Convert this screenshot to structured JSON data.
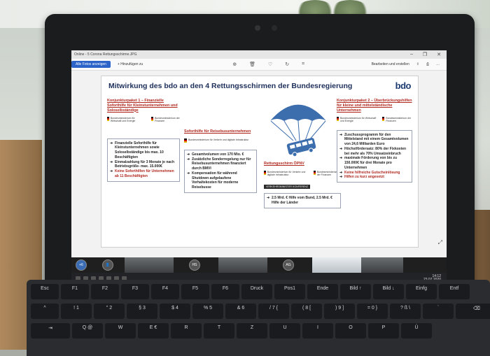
{
  "app": {
    "tab_title": "Online - 5 Corona Rettungsschirme.JPG",
    "toolbar": {
      "all_photos": "Alle Fotos anzeigen",
      "add_to": "+ Hinzufügen zu",
      "edit_create": "Bearbeiten und erstellen"
    }
  },
  "slide": {
    "title": "Mitwirkung des bdo an den 4 Rettungsschirmen der Bundesregierung",
    "logo": "bdo",
    "col1": {
      "heading": "Konjunkturpaket 1 – Finanzielle Soforthilfe für Kleinstunternehmen und Soloselbständige",
      "logos": [
        "Bundesministerium für Wirtschaft und Energie",
        "Bundesministerium der Finanzen"
      ],
      "items": [
        {
          "text": "Finanzielle Soforthilfe für Kleinstunternehmen sowie Soloselbständige bis max. 10 Beschäftigten",
          "red": false
        },
        {
          "text": "Einmalzahlung für 3 Monate je nach Betriebsgröße- max. 15.000€",
          "red": false
        },
        {
          "text": "Keine Soforthilfen für Unternehmen ab 11 Beschäftigten",
          "red": true
        }
      ]
    },
    "col2": {
      "heading": "Soforthilfe für Reisebusunternehmen",
      "logos": [
        "Bundesministerium für Verkehr und digitale Infrastruktur"
      ],
      "items": [
        {
          "text": "Gesamtvolumen von 170 Mio. €",
          "red": false
        },
        {
          "text": "Zusätzliche Sonderregelung nur für Reisebusunternehmen finanziert durch BMVI",
          "red": false
        },
        {
          "text": "Kompensation für während Shutdown aufgelaufene Vorhaltekosten für moderne Reisebusse",
          "red": false
        }
      ]
    },
    "col3": {
      "heading": "Rettungsschirm ÖPNV",
      "logos": [
        "Bundesministerium für Verkehr und digitale Infrastruktur",
        "Bundesministerium der Finanzen"
      ],
      "label": "VERKEHRSMINISTER KONFERENZ",
      "items": [
        {
          "text": "2.5 Mrd. € Hilfe vom Bund, 2.5 Mrd. € Hilfe der Länder",
          "red": false
        }
      ]
    },
    "col4": {
      "heading": "Konjunkturpaket 2 – Überbrückungshilfen für kleine und mittelständische Unternehmen",
      "logos": [
        "Bundesministerium für Wirtschaft und Energie",
        "Bundesministerium der Finanzen"
      ],
      "items": [
        {
          "text": "Zuschussprogramm für den Mittelstand mit einem Gesamtvolumen von 24,6 Milliarden Euro",
          "red": false
        },
        {
          "text": "Höchstfördersatz: 80% der Fixkosten bei mehr als 70% Umsatzeinbruch",
          "red": false
        },
        {
          "text": "maximale Förderung von bis zu 150.000€ für drei Monate pro Unternehmen",
          "red": false
        },
        {
          "text": "Keine hilfreiche Gutscheinlösung",
          "red": true
        },
        {
          "text": "Hilfen zu kurz angesetzt",
          "red": true
        }
      ]
    }
  },
  "meeting": {
    "avatars": [
      "+6",
      "HS",
      "AG"
    ]
  },
  "taskbar": {
    "time": "14:12",
    "date": "23.07.2020"
  },
  "keyboard": {
    "row1": [
      "Esc",
      "F1",
      "F2",
      "F3",
      "F4",
      "F5",
      "F6",
      "Druck",
      "Pos1",
      "Ende",
      "Bild ↑",
      "Bild ↓",
      "Einfg",
      "Entf"
    ],
    "row2": [
      "^",
      "! 1",
      "\" 2",
      "§ 3",
      "$ 4",
      "% 5",
      "& 6",
      "/ 7 {",
      "( 8 [",
      ") 9 ]",
      "= 0 }",
      "? ß \\",
      "`",
      "⌫"
    ],
    "row3": [
      "⇥",
      "Q @",
      "W",
      "E €",
      "R",
      "T",
      "Z",
      "U",
      "I",
      "O",
      "P",
      "Ü"
    ]
  }
}
